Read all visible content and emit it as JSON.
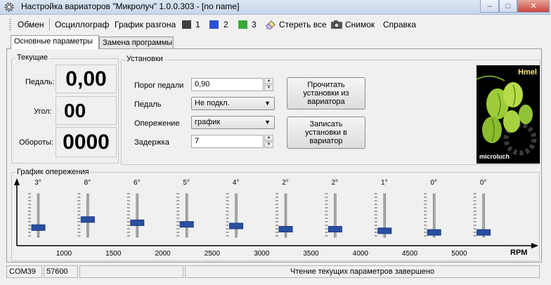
{
  "window": {
    "title": "Настройка вариаторов \"Микролуч\" 1.0.0.303 - [no name]",
    "controls": {
      "minimize": "–",
      "maximize": "□",
      "close": "✕"
    }
  },
  "menu": {
    "exchange": "Обмен",
    "oscilloscope": "Осциллограф",
    "accel_chart": "График разгона",
    "slot1": "1",
    "slot2": "2",
    "slot3": "3",
    "erase_all": "Стереть все",
    "snapshot": "Снимок",
    "help": "Справка"
  },
  "colors": {
    "slot1": "#404040",
    "slot2": "#2f4fd6",
    "slot3": "#3aaa3a",
    "slider_thumb": "#2a4fa0"
  },
  "tabs": [
    {
      "label": "Основные параметры",
      "active": true
    },
    {
      "label": "Замена программы",
      "active": false
    }
  ],
  "current": {
    "group_title": "Текущие",
    "pedal_label": "Педаль:",
    "pedal_value": "0,00",
    "angle_label": "Угол:",
    "angle_value": "00",
    "rpm_label": "Обороты:",
    "rpm_value": "0000"
  },
  "settings": {
    "group_title": "Установки",
    "pedal_threshold_label": "Порог педали",
    "pedal_threshold_value": "0,90",
    "pedal_label": "Педаль",
    "pedal_value": "Не подкл.",
    "advance_label": "Опережение",
    "advance_value": "график",
    "delay_label": "Задержка",
    "delay_value": "7",
    "read_button": "Прочитать\nустановки из\nвариатора",
    "write_button": "Записать\nустановки в\nвариатор"
  },
  "logo": {
    "top_text": "Hmel",
    "bottom_text": "microluch"
  },
  "chart_data": {
    "type": "slider-chart",
    "title": "График опережения",
    "xlabel": "RPM",
    "x_ticks": [
      1000,
      1500,
      2000,
      2500,
      3000,
      3500,
      4000,
      4500,
      5000
    ],
    "angle_labels": [
      "3°",
      "8°",
      "6°",
      "5°",
      "4°",
      "2°",
      "2°",
      "1°",
      "0°",
      "0°"
    ],
    "values": [
      3,
      8,
      6,
      5,
      4,
      2,
      2,
      1,
      0,
      0
    ],
    "ylim": [
      -3,
      24
    ]
  },
  "status": {
    "port": "COM39",
    "baud": "57600",
    "empty": "",
    "message": "Чтение текущих параметров завершено"
  }
}
